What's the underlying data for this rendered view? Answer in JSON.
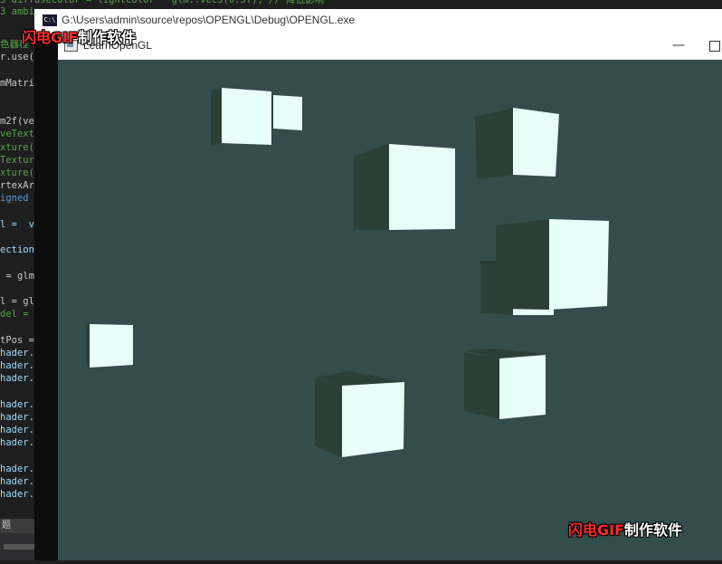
{
  "editor": {
    "top_lines": [
      {
        "text": "3 diffuseColor = lightColor * glm::vec3(0.5f); // 降低影响",
        "cls": "c-comment"
      },
      {
        "text": "3 ambie",
        "cls": "c-comment"
      }
    ],
    "lines": [
      {
        "text": "色器程",
        "cls": "c-comment"
      },
      {
        "text": "r.use()",
        "cls": "c-ident"
      },
      {
        "text": "",
        "cls": "c-ident"
      },
      {
        "text": "mMatri",
        "cls": "c-ident"
      },
      {
        "text": "",
        "cls": "c-ident"
      },
      {
        "text": "",
        "cls": "c-ident"
      },
      {
        "text": "m2f(ver",
        "cls": "c-ident"
      },
      {
        "text": "veTextu",
        "cls": "c-comment"
      },
      {
        "text": "xture(G",
        "cls": "c-comment"
      },
      {
        "text": "Texture",
        "cls": "c-comment"
      },
      {
        "text": "xture(G",
        "cls": "c-comment"
      },
      {
        "text": "rtexArr",
        "cls": "c-ident"
      },
      {
        "text": "igned i",
        "cls": "c-kw"
      },
      {
        "text": "",
        "cls": "c-ident"
      },
      {
        "text": "l =  vi",
        "cls": "c-var"
      },
      {
        "text": "",
        "cls": "c-ident"
      },
      {
        "text": "ection",
        "cls": "c-var"
      },
      {
        "text": "",
        "cls": "c-ident"
      },
      {
        "text": " = glm:",
        "cls": "c-ident"
      },
      {
        "text": "",
        "cls": "c-ident"
      },
      {
        "text": "l = glm",
        "cls": "c-ident"
      },
      {
        "text": "del = g",
        "cls": "c-comment"
      },
      {
        "text": "",
        "cls": "c-ident"
      },
      {
        "text": "tPos =",
        "cls": "c-ident"
      },
      {
        "text": "hader.s",
        "cls": "c-var"
      },
      {
        "text": "hader.s",
        "cls": "c-var"
      },
      {
        "text": "hader.s",
        "cls": "c-var"
      },
      {
        "text": "",
        "cls": "c-ident"
      },
      {
        "text": "hader.s",
        "cls": "c-var"
      },
      {
        "text": "hader.s",
        "cls": "c-var"
      },
      {
        "text": "hader.s",
        "cls": "c-var"
      },
      {
        "text": "hader.s",
        "cls": "c-var"
      },
      {
        "text": "",
        "cls": "c-ident"
      },
      {
        "text": "hader.setVe",
        "cls": "c-var"
      },
      {
        "text": "hader.setVe",
        "cls": "c-var"
      },
      {
        "text": "hader.setVe",
        "cls": "c-var"
      }
    ],
    "status_text": "题"
  },
  "console": {
    "icon_text": "C:\\",
    "title": "G:\\Users\\admin\\source\\repos\\OPENGL\\Debug\\OPENGL.exe"
  },
  "glwindow": {
    "title": "LearnOpenGL",
    "minimize_glyph": "—",
    "background_color": "#334d4d",
    "cube_color_lit": "#e6fff8",
    "cube_color_shaded": "#2a4036"
  },
  "watermark": {
    "red_part": "闪电GIF",
    "white_part": "制作软件"
  }
}
